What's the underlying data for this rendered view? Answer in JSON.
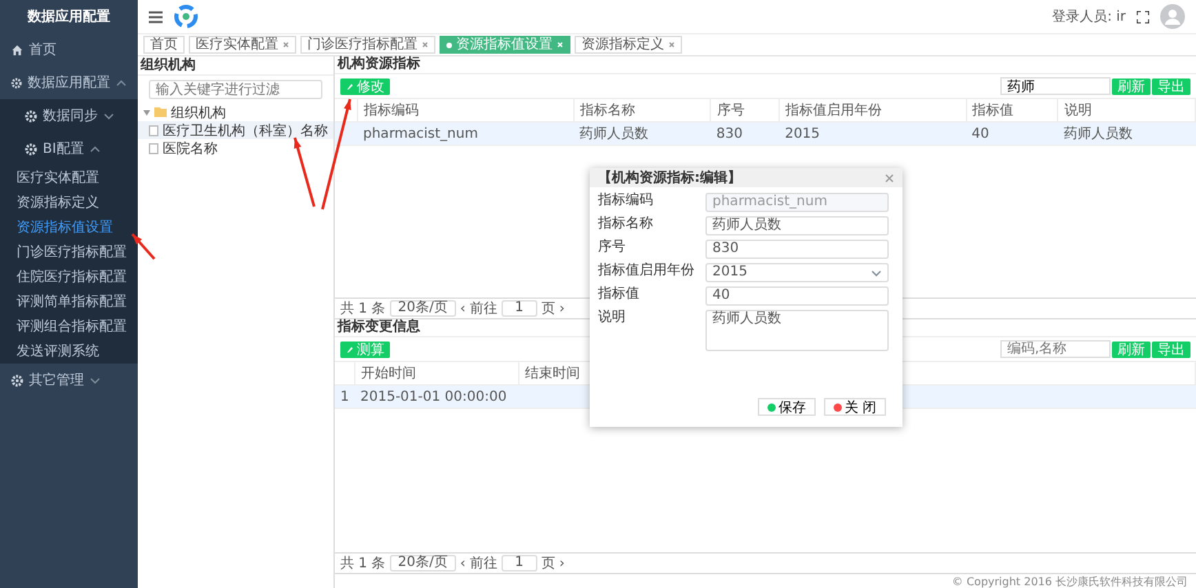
{
  "app_title": "数据应用配置",
  "sidebar": {
    "items": [
      {
        "label": "首页",
        "kind": "home"
      },
      {
        "label": "数据应用配置",
        "kind": "group",
        "expanded": true,
        "children": [
          {
            "label": "数据同步",
            "kind": "group",
            "expanded": false
          },
          {
            "label": "BI配置",
            "kind": "group",
            "expanded": true,
            "children": [
              {
                "label": "医疗实体配置",
                "kind": "link",
                "selected": false
              },
              {
                "label": "资源指标定义",
                "kind": "link",
                "selected": false
              },
              {
                "label": "资源指标值设置",
                "kind": "link",
                "selected": true
              },
              {
                "label": "门诊医疗指标配置",
                "kind": "link",
                "selected": false
              },
              {
                "label": "住院医疗指标配置",
                "kind": "link",
                "selected": false
              },
              {
                "label": "评测简单指标配置",
                "kind": "link",
                "selected": false
              },
              {
                "label": "评测组合指标配置",
                "kind": "link",
                "selected": false
              },
              {
                "label": "发送评测系统",
                "kind": "link",
                "selected": false
              }
            ]
          }
        ]
      },
      {
        "label": "其它管理",
        "kind": "group",
        "expanded": false
      }
    ]
  },
  "header": {
    "user_label": "登录人员: ir"
  },
  "tabs": [
    {
      "label": "首页",
      "closable": false,
      "selected": false
    },
    {
      "label": "医疗实体配置",
      "closable": true,
      "selected": false
    },
    {
      "label": "门诊医疗指标配置",
      "closable": true,
      "selected": false
    },
    {
      "label": "资源指标值设置",
      "closable": true,
      "selected": true
    },
    {
      "label": "资源指标定义",
      "closable": true,
      "selected": false
    }
  ],
  "org_panel": {
    "title": "组织机构",
    "filter_placeholder": "输入关键字进行过滤",
    "tree": [
      {
        "label": "组织机构",
        "expanded": true,
        "children": [
          {
            "label": "医疗卫生机构（科室）名称",
            "selected": true
          },
          {
            "label": "医院名称",
            "selected": false
          }
        ]
      }
    ]
  },
  "resource_panel": {
    "title": "机构资源指标",
    "edit_button": "修改",
    "search_value": "药师",
    "buttons": [
      "刷新",
      "导出"
    ],
    "columns": [
      "指标编码",
      "指标名称",
      "序号",
      "指标值启用年份",
      "指标值",
      "说明"
    ],
    "rows": [
      {
        "selected": true,
        "cells": [
          "pharmacist_num",
          "药师人员数",
          "830",
          "2015",
          "40",
          "药师人员数"
        ]
      }
    ],
    "pager": {
      "total": "共 1 条",
      "page_size": "20条/页",
      "prev": "‹",
      "goto": "前往",
      "page": "1",
      "unit": "页",
      "next": "›"
    }
  },
  "change_panel": {
    "title": "指标变更信息",
    "action_button": "测算",
    "search_placeholder": "编码,名称",
    "buttons": [
      "刷新",
      "导出"
    ],
    "columns": [
      "开始时间",
      "结束时间"
    ],
    "rows": [
      {
        "selected": true,
        "index": "1",
        "cells": [
          "2015-01-01 00:00:00"
        ]
      }
    ],
    "pager": {
      "total": "共 1 条",
      "page_size": "20条/页",
      "prev": "‹",
      "goto": "前往",
      "page": "1",
      "unit": "页",
      "next": "›"
    }
  },
  "dialog": {
    "title": "【机构资源指标:编辑】",
    "fields": [
      {
        "label": "指标编码",
        "value": "pharmacist_num",
        "kind": "text",
        "disabled": true
      },
      {
        "label": "指标名称",
        "value": "药师人员数",
        "kind": "text",
        "disabled": false
      },
      {
        "label": "序号",
        "value": "830",
        "kind": "text",
        "disabled": false
      },
      {
        "label": "指标值启用年份",
        "value": "2015",
        "kind": "select",
        "disabled": false
      },
      {
        "label": "指标值",
        "value": "40",
        "kind": "text",
        "disabled": false
      },
      {
        "label": "说明",
        "value": "药师人员数",
        "kind": "textarea",
        "disabled": false
      }
    ],
    "buttons": [
      {
        "label": "保存",
        "kind": "save"
      },
      {
        "label": "关 闭",
        "kind": "close"
      }
    ]
  },
  "footer": "© Copyright 2016 长沙康氏软件科技有限公司"
}
